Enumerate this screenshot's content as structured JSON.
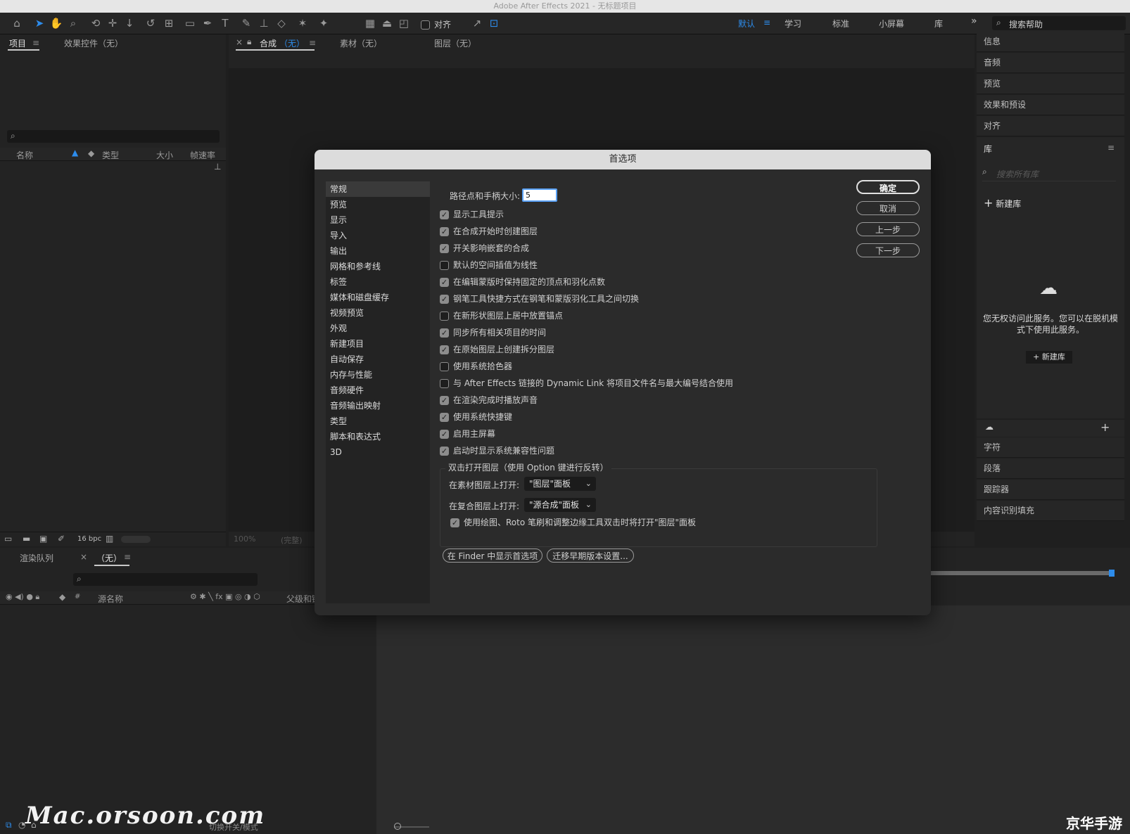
{
  "window": {
    "title": "Adobe After Effects 2021 - 无标题项目"
  },
  "toolbar": {
    "align_label": "对齐",
    "workspaces": [
      "默认",
      "学习",
      "标准",
      "小屏幕",
      "库"
    ],
    "more": "»",
    "help_search_placeholder": "搜索帮助"
  },
  "project_panel": {
    "tab_project": "项目",
    "tab_effects": "效果控件（无）",
    "columns": [
      "名称",
      "类型",
      "大小",
      "帧速率"
    ],
    "bpc": "16 bpc"
  },
  "comp_panel": {
    "tab_comp": "合成",
    "tab_comp_value": "（无）",
    "tab_footage": "素材（无）",
    "tab_layer": "图层（无）",
    "zoom": "100%",
    "resolution": "(完整)"
  },
  "timeline": {
    "tab_render": "渲染队列",
    "tab_none": "（无）",
    "col_source": "源名称",
    "col_parent": "父级和链",
    "switch_mode": "切换开关/模式"
  },
  "right_panel": {
    "items": [
      "信息",
      "音频",
      "预览",
      "效果和预设",
      "对齐"
    ],
    "library_title": "库",
    "library_search_placeholder": "搜索所有库",
    "new_library": "新建库",
    "no_access_message": "您无权访问此服务。您可以在脱机模式下使用此服务。",
    "new_library_button": "+ 新建库",
    "lower_items": [
      "字符",
      "段落",
      "跟踪器",
      "内容识别填充"
    ]
  },
  "dialog": {
    "title": "首选项",
    "sidebar": [
      "常规",
      "预览",
      "显示",
      "导入",
      "输出",
      "网格和参考线",
      "标签",
      "媒体和磁盘缓存",
      "视频预览",
      "外观",
      "新建项目",
      "自动保存",
      "内存与性能",
      "音频硬件",
      "音频输出映射",
      "类型",
      "脚本和表达式",
      "3D"
    ],
    "selected_index": 0,
    "path_point_label": "路径点和手柄大小:",
    "path_point_value": "5",
    "options": [
      {
        "label": "显示工具提示",
        "checked": true
      },
      {
        "label": "在合成开始时创建图层",
        "checked": true
      },
      {
        "label": "开关影响嵌套的合成",
        "checked": true
      },
      {
        "label": "默认的空间插值为线性",
        "checked": false
      },
      {
        "label": "在编辑蒙版时保持固定的顶点和羽化点数",
        "checked": true
      },
      {
        "label": "钢笔工具快捷方式在钢笔和蒙版羽化工具之间切换",
        "checked": true
      },
      {
        "label": "在新形状图层上居中放置锚点",
        "checked": false
      },
      {
        "label": "同步所有相关项目的时间",
        "checked": true
      },
      {
        "label": "在原始图层上创建拆分图层",
        "checked": true
      },
      {
        "label": "使用系统拾色器",
        "checked": false
      },
      {
        "label": "与 After Effects 链接的 Dynamic Link 将项目文件名与最大编号结合使用",
        "checked": false
      },
      {
        "label": "在渲染完成时播放声音",
        "checked": true
      },
      {
        "label": "使用系统快捷键",
        "checked": true
      },
      {
        "label": "启用主屏幕",
        "checked": true
      },
      {
        "label": "启动时显示系统兼容性问题",
        "checked": true
      }
    ],
    "double_click_group": "双击打开图层（使用 Option 键进行反转）",
    "footage_label": "在素材图层上打开:",
    "footage_value": "\"图层\"面板",
    "comp_label": "在复合图层上打开:",
    "comp_value": "\"源合成\"面板",
    "paint_option": {
      "label": "使用绘图、Roto 笔刷和调整边缘工具双击时将打开\"图层\"面板",
      "checked": true
    },
    "btn_ok": "确定",
    "btn_cancel": "取消",
    "btn_prev": "上一步",
    "btn_next": "下一步",
    "btn_finder": "在 Finder 中显示首选项",
    "btn_migrate": "迁移早期版本设置..."
  },
  "watermarks": {
    "left": "Mac.orsoon.com",
    "right": "京华手游"
  }
}
